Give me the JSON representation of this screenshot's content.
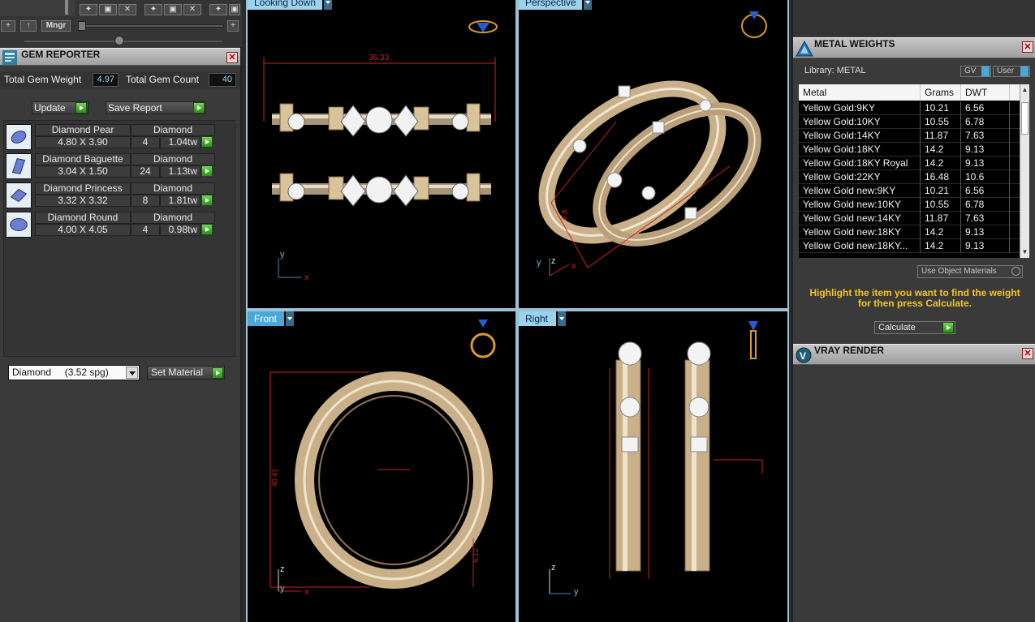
{
  "toolbar": {
    "mngr_label": "Mngr",
    "plus_label": "+",
    "up_label": "↑"
  },
  "gem_reporter": {
    "title": "GEM REPORTER",
    "total_weight_label": "Total Gem Weight",
    "total_weight_value": "4.97",
    "total_count_label": "Total Gem Count",
    "total_count_value": "40",
    "update_label": "Update",
    "save_label": "Save Report",
    "gems": [
      {
        "name": "Diamond Pear",
        "material": "Diamond",
        "size": "4.80 X 3.90",
        "count": "4",
        "weight": "1.04tw",
        "icon": "pear"
      },
      {
        "name": "Diamond Baguette",
        "material": "Diamond",
        "size": "3.04 X 1.50",
        "count": "24",
        "weight": "1.13tw",
        "icon": "baguette"
      },
      {
        "name": "Diamond Princess",
        "material": "Diamond",
        "size": "3.32 X 3.32",
        "count": "8",
        "weight": "1.81tw",
        "icon": "princess"
      },
      {
        "name": "Diamond Round",
        "material": "Diamond",
        "size": "4.00 X 4.05",
        "count": "4",
        "weight": "0.98tw",
        "icon": "round"
      }
    ],
    "material_select": "Diamond     (3.52 spg)",
    "set_material_label": "Set Material"
  },
  "viewports": {
    "top_left": {
      "label": "Looking Down",
      "dimension": "36.33",
      "axis_a": "y",
      "axis_b": "x"
    },
    "top_right": {
      "label": "Perspective",
      "dimension": "6.8",
      "axis_a": "z",
      "axis_b": "x",
      "axis_c": "y"
    },
    "bottom_left": {
      "label": "Front",
      "dimension": "40.41",
      "dimension2": "6.12",
      "axis_a": "z",
      "axis_b": "x",
      "axis_c": "y"
    },
    "bottom_right": {
      "label": "Right",
      "axis_a": "z",
      "axis_b": "y"
    }
  },
  "metal_weights": {
    "title": "METAL WEIGHTS",
    "library_label": "Library: METAL",
    "gv_label": "GV",
    "user_label": "User",
    "columns": [
      "Metal",
      "Grams",
      "DWT"
    ],
    "rows": [
      [
        "Yellow Gold:9KY",
        "10.21",
        "6.56"
      ],
      [
        "Yellow Gold:10KY",
        "10.55",
        "6.78"
      ],
      [
        "Yellow Gold:14KY",
        "11.87",
        "7.63"
      ],
      [
        "Yellow Gold:18KY",
        "14.2",
        "9.13"
      ],
      [
        "Yellow Gold:18KY Royal",
        "14.2",
        "9.13"
      ],
      [
        "Yellow Gold:22KY",
        "16.48",
        "10.6"
      ],
      [
        "Yellow Gold new:9KY",
        "10.21",
        "6.56"
      ],
      [
        "Yellow Gold new:10KY",
        "10.55",
        "6.78"
      ],
      [
        "Yellow Gold new:14KY",
        "11.87",
        "7.63"
      ],
      [
        "Yellow Gold new:18KY",
        "14.2",
        "9.13"
      ],
      [
        "Yellow Gold new:18KY...",
        "14.2",
        "9.13"
      ]
    ],
    "use_object_label": "Use Object Materials",
    "info_text": "Highlight the item you want to find the weight for then press Calculate.",
    "calculate_label": "Calculate"
  },
  "vray": {
    "title": "VRAY RENDER"
  },
  "colors": {
    "accent": "#9ad4ec",
    "gold": "#d8c39a",
    "dimension_red": "#cc2222",
    "go_green": "#3fae2a"
  }
}
